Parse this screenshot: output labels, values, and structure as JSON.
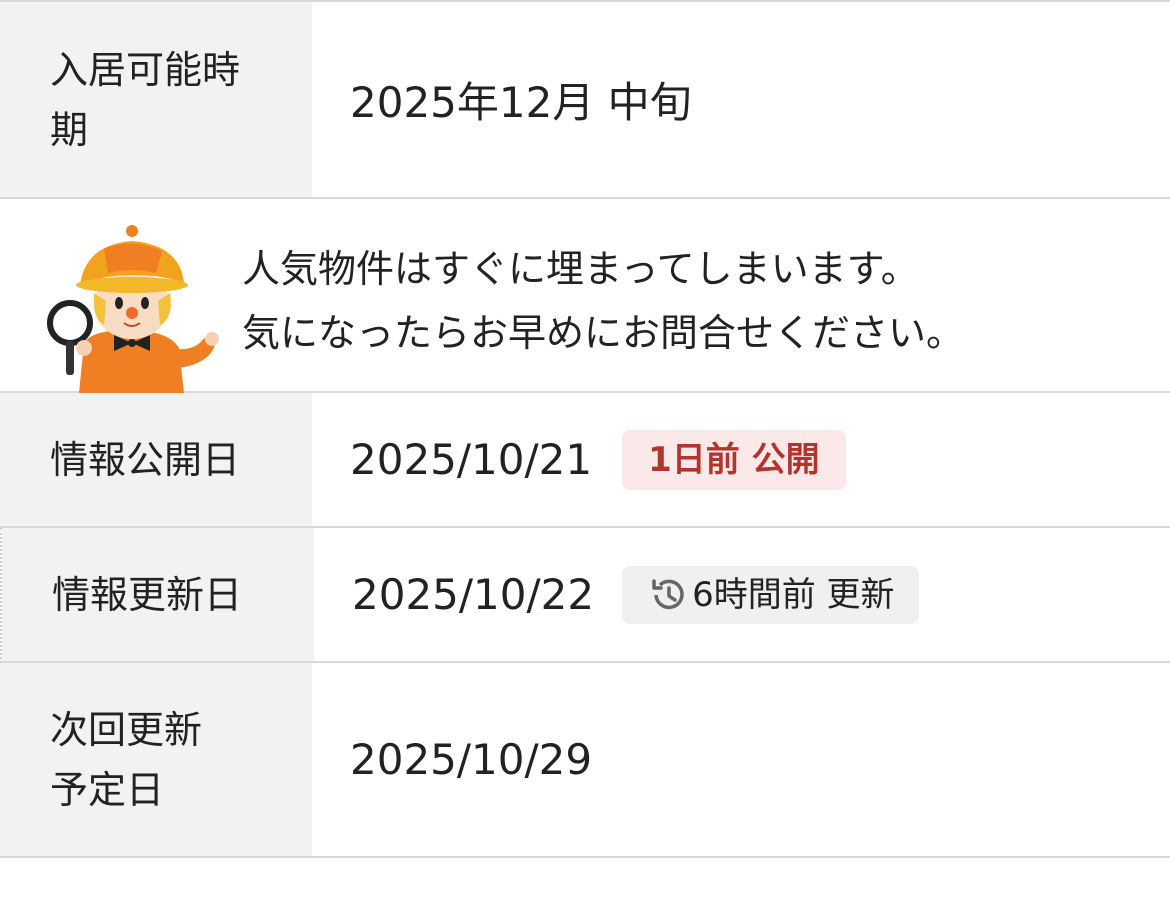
{
  "rows": {
    "move_in": {
      "label_line1": "入居可能時",
      "label_line2": "期",
      "value": "2025年12月 中旬"
    },
    "published": {
      "label": "情報公開日",
      "value": "2025/10/21",
      "badge": "1日前 公開"
    },
    "updated": {
      "label": "情報更新日",
      "value": "2025/10/22",
      "badge": "6時間前 更新",
      "badge_icon": "history-icon"
    },
    "next_update": {
      "label_line1": "次回更新",
      "label_line2": "予定日",
      "value": "2025/10/29"
    }
  },
  "promo": {
    "line1": "人気物件はすぐに埋まってしまいます。",
    "line2": "気になったらお早めにお問合せください。",
    "mascot_icon": "detective-mascot-icon"
  },
  "colors": {
    "label_bg": "#f2f2f2",
    "border": "#d9d9d9",
    "badge_red_bg": "#fbe9e9",
    "badge_red_text": "#b3342b",
    "badge_gray_bg": "#f0f0f0"
  }
}
